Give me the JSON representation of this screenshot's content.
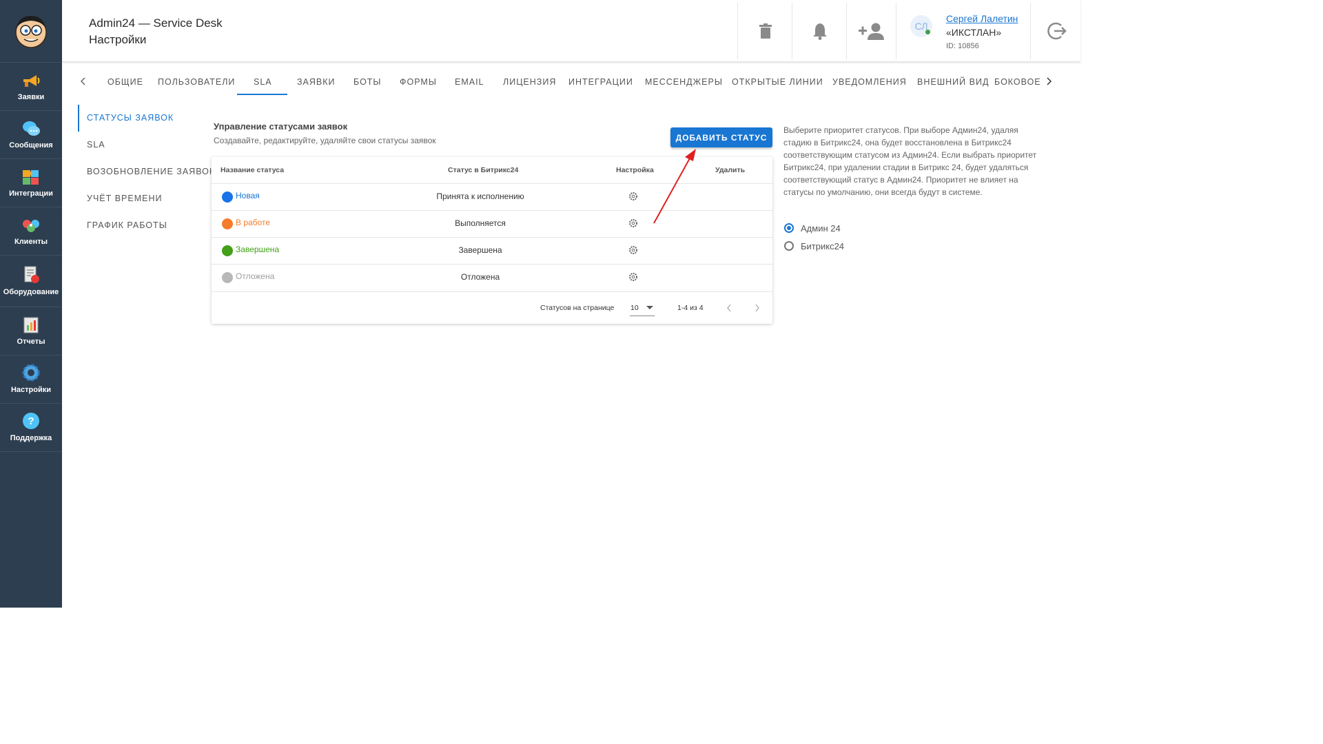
{
  "header": {
    "title_line1": "Admin24 — Service Desk",
    "title_line2": "Настройки"
  },
  "user": {
    "initials": "СЛ",
    "name": "Сергей Лалетин",
    "company": "«ИКСТЛАН»",
    "id": "ID: 10856"
  },
  "sidebar": {
    "items": [
      {
        "label": "Заявки",
        "icon": "megaphone-icon"
      },
      {
        "label": "Сообщения",
        "icon": "chat-bubbles-icon"
      },
      {
        "label": "Интеграции",
        "icon": "puzzle-icon"
      },
      {
        "label": "Клиенты",
        "icon": "people-icon"
      },
      {
        "label": "Оборудование",
        "icon": "equipment-icon"
      },
      {
        "label": "Отчеты",
        "icon": "report-icon"
      },
      {
        "label": "Настройки",
        "icon": "gear-icon"
      },
      {
        "label": "Поддержка",
        "icon": "help-icon"
      }
    ]
  },
  "tabs": [
    "Общие",
    "Пользователи",
    "SLA",
    "Заявки",
    "Боты",
    "Формы",
    "Email",
    "Лицензия",
    "Интеграции",
    "Мессенджеры",
    "Открытые линии",
    "Уведомления",
    "Внешний вид",
    "Боковое"
  ],
  "active_tab": "SLA",
  "subnav": [
    "Статусы заявок",
    "SLA",
    "Возобновление заявок",
    "Учёт времени",
    "График работы"
  ],
  "active_subnav": "Статусы заявок",
  "main": {
    "title": "Управление статусами заявок",
    "subtitle": "Создавайте, редактируйте, удаляйте свои статусы заявок",
    "add_button": "Добавить статус",
    "columns": [
      "Название статуса",
      "Статус в Битрикс24",
      "Настройка",
      "Удалить"
    ],
    "rows": [
      {
        "name": "Новая",
        "bitrix": "Принята к исполнению",
        "color": "#1a73e8",
        "text_color": "#1976d2"
      },
      {
        "name": "В работе",
        "bitrix": "Выполняется",
        "color": "#f57c2b",
        "text_color": "#f57c2b"
      },
      {
        "name": "Завершена",
        "bitrix": "Завершена",
        "color": "#43a018",
        "text_color": "#43a018"
      },
      {
        "name": "Отложена",
        "bitrix": "Отложена",
        "color": "#b8b8b8",
        "text_color": "#9e9e9e"
      }
    ],
    "pagination": {
      "rows_label": "Статусов на странице",
      "rows_value": "10",
      "range": "1-4 из 4"
    }
  },
  "info": {
    "text": "Выберите приоритет статусов. При выборе Админ24, удаляя стадию в Битрикс24, она будет восстановлена в Битрикс24 соответствующим статусом из Админ24. Если выбрать приоритет Битрикс24, при удалении стадии в Битрикс 24, будет удаляться соответствующий статус в Админ24. Приоритет не влияет на статусы по умолчанию, они всегда будут в системе.",
    "options": [
      "Админ 24",
      "Битрикс24"
    ],
    "selected": "Админ 24"
  },
  "colors": {
    "sidebar_bg": "#2d3e50",
    "accent": "#1976d2",
    "annotation_arrow": "#e02020"
  }
}
